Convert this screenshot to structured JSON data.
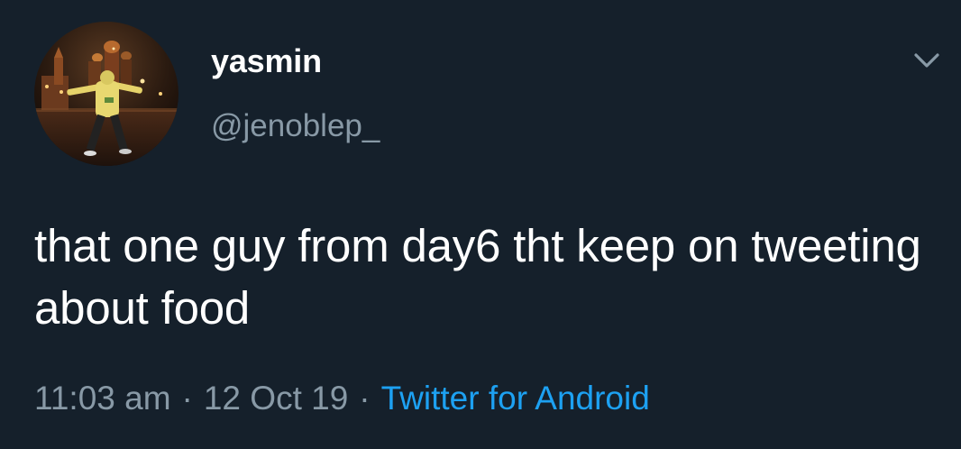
{
  "tweet": {
    "author": {
      "display_name": "yasmin",
      "handle": "@jenoblep_",
      "avatar_icon": "profile-photo"
    },
    "text": "that one guy from day6 tht keep on tweeting about food",
    "time": "11:03 am",
    "date": "12 Oct 19",
    "source": "Twitter for Android",
    "separator": "·",
    "menu_icon": "chevron-down-icon"
  },
  "colors": {
    "background": "#15202b",
    "primary_text": "#ffffff",
    "secondary_text": "#8899a6",
    "link": "#1da1f2"
  }
}
